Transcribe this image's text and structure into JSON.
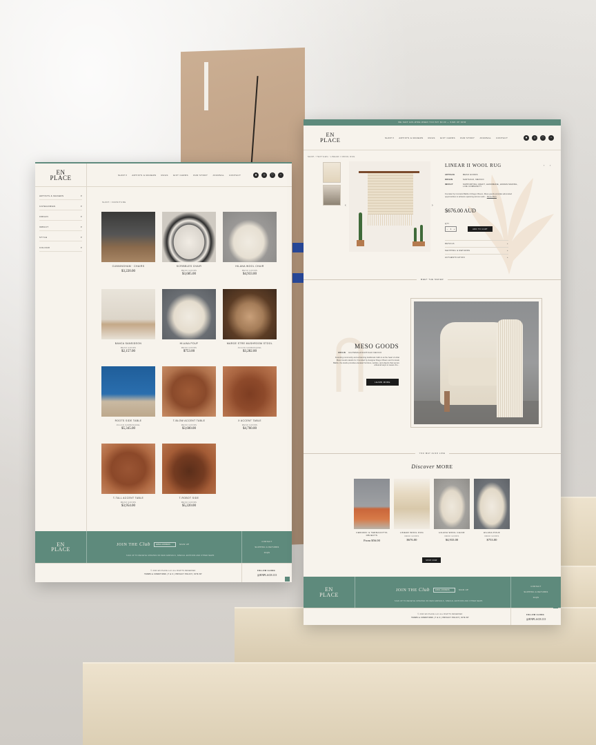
{
  "brand": {
    "logo_line1": "EN",
    "logo_line2": "PLACE"
  },
  "nav": [
    "SHOP ▾",
    "ARTISTS & MAKERS",
    "RUGS",
    "GIFT CARDS",
    "OUR STORY",
    "JOURNAL",
    "CONTACT"
  ],
  "icons": [
    "account-icon",
    "search-icon",
    "wishlist-icon",
    "cart-icon"
  ],
  "collection_page": {
    "filters": [
      "ARTISTS & MAKERS",
      "CATEGORIES",
      "ORIGIN",
      "IMPACT",
      "STYLE",
      "COLOUR"
    ],
    "breadcrumb": "SHOP  /  FURNITURE",
    "products": [
      {
        "name": "CUNNINGHAM · CHAIRS",
        "brand": "",
        "price": "$3,220.00"
      },
      {
        "name": "SCRIBBLES CHAIR",
        "brand": "MESO GOODS",
        "price": "$3,685.00"
      },
      {
        "name": "HILANA WOOL CHAIR",
        "brand": "MESO GOODS",
        "price": "$4,933.00"
      },
      {
        "name": "BANCA SANSIDEON",
        "brand": "MESO GOODS",
        "price": "$2,157.00"
      },
      {
        "name": "HILANA POUF",
        "brand": "MESO GOODS",
        "price": "$753.00"
      },
      {
        "name": "MARGE STRE MUSHROOM STOOL",
        "brand": "JULIAN CARRASQUEL",
        "price": "$3,282.00"
      },
      {
        "name": "ROOTS SIDE TABLE",
        "brand": "JULIAN CARRASQUEL",
        "price": "$5,345.00"
      },
      {
        "name": "T-BLOW ACCENT TABLE",
        "brand": "MESO GOODS",
        "price": "$3,600.00"
      },
      {
        "name": "X ACCENT TABLE",
        "brand": "MESO GOODS",
        "price": "$4,760.00"
      },
      {
        "name": "T-TALL ACCENT TABLE",
        "brand": "MESO GOODS",
        "price": "$3,954.00"
      },
      {
        "name": "T-ROBOT SIDE",
        "brand": "MESO GOODS",
        "price": "$5,220.00"
      }
    ]
  },
  "product_page": {
    "announcement": "WE SHIP AUS-WIDE WHEN YOU PAY $0.00 — SIGN UP NOW",
    "breadcrumb": "SHOP  /  TEXTILES  /  LINEAR II WOOL RUG",
    "title": "LINEAR II WOOL RUG",
    "specs": [
      {
        "label": "ARTISAN",
        "value": "MESO GOODS"
      },
      {
        "label": "ORIGIN",
        "value": "SANTIAGO, MEXICO"
      },
      {
        "label": "IMPACT",
        "value": "SUPPORTING CRAFT, HANDMADE, HUMAN MAKING, LIVE COMMUNITY"
      }
    ],
    "description": "Founded by Conrado Babilo & Diego Olivero, Meso goods provides advocated opportunities to artisans spanning across Latin...",
    "more_link": "Show More",
    "price": "$676.00 AUD",
    "qty_label": "QTY",
    "qty_value": "1",
    "add_to_cart": "ADD TO CART",
    "accordions": [
      "DETAILS",
      "SHIPPING & RETURNS",
      "AUTHENTICATION"
    ],
    "meet_label": "MEET THE MAKER",
    "maker": {
      "name": "MESO GOODS",
      "origin_label": "ORIGIN",
      "origin": "GUATEMALA/SANTIAGO MEXICO",
      "description": "Founding community and enhancing traditional crafts is at the heart of what Meso Goods stands for. Founded by designer Diego Olivero and Conrado Babilo, the studio provides elevated furniture, textiles, and objects that secure artisanal ways to weave the...",
      "button": "LEARN MORE"
    },
    "like_label": "YOU MAY ALSO LIKE",
    "discover_a": "Discover",
    "discover_b": "MORE",
    "related": [
      {
        "name": "CERAMIC & TERRACOTTA OBJECTS",
        "brand": "",
        "price": "From $56.00"
      },
      {
        "name": "LINEAR WOOL RUG",
        "brand": "MESO GOODS",
        "price": "$676.00"
      },
      {
        "name": "HILANA WOOL CHAIR",
        "brand": "MESO GOODS",
        "price": "$4,933.00"
      },
      {
        "name": "HILANA POUF",
        "brand": "MESO GOODS",
        "price": "$753.00"
      }
    ],
    "shop_now": "SHOP NOW"
  },
  "footer": {
    "join_a": "JOIN THE",
    "join_b": "Club",
    "email_placeholder": "EMAIL ADDRESS",
    "signup": "SIGN UP",
    "join_note": "SIGN UP TO RECEIVE UPDATES ON NEW ARRIVALS, SPECIAL EDITIONS AND OTHER NEWS",
    "links": [
      "CONTACT",
      "SHIPPING & RETURNS",
      "FAQS"
    ],
    "copyright": "© 2023 EN PLACE LLC  ALL RIGHTS RESERVED",
    "legal": "TERMS & CONDITIONS  |  T & C  |  PRIVACY POLICY  |  SITE BY",
    "follow_label": "FOLLOW ALONG",
    "handle": "@ENPLACE.CO"
  },
  "colors": {
    "accent": "#5e8a7c",
    "cream": "#f7f3ec",
    "ink": "#1c1c1c"
  }
}
